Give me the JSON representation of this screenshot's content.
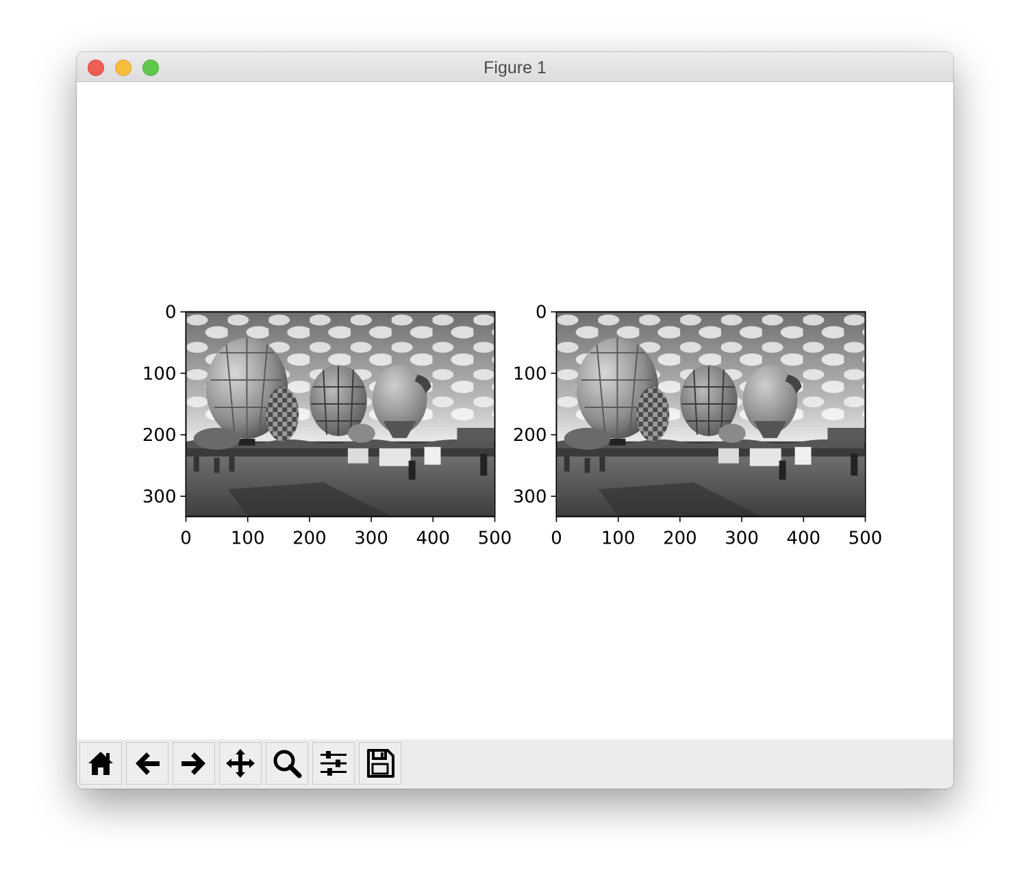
{
  "window": {
    "title": "Figure 1"
  },
  "toolbar": {
    "buttons": [
      {
        "icon": "home-icon",
        "name": "home-button"
      },
      {
        "icon": "arrow-left-icon",
        "name": "back-button"
      },
      {
        "icon": "arrow-right-icon",
        "name": "forward-button"
      },
      {
        "icon": "move-icon",
        "name": "pan-button"
      },
      {
        "icon": "magnifier-icon",
        "name": "zoom-button"
      },
      {
        "icon": "sliders-icon",
        "name": "configure-subplots-button"
      },
      {
        "icon": "floppy-disk-icon",
        "name": "save-button"
      }
    ]
  },
  "chart_data": [
    {
      "type": "image",
      "image_content": "grayscale photo of hot air balloons",
      "xlim": [
        0,
        500
      ],
      "ylim": [
        333,
        0
      ],
      "xticks": [
        "0",
        "100",
        "200",
        "300",
        "400",
        "500"
      ],
      "yticks": [
        "0",
        "100",
        "200",
        "300"
      ]
    },
    {
      "type": "image",
      "image_content": "grayscale photo of hot air balloons",
      "xlim": [
        0,
        500
      ],
      "ylim": [
        333,
        0
      ],
      "xticks": [
        "0",
        "100",
        "200",
        "300",
        "400",
        "500"
      ],
      "yticks": [
        "0",
        "100",
        "200",
        "300"
      ]
    }
  ]
}
